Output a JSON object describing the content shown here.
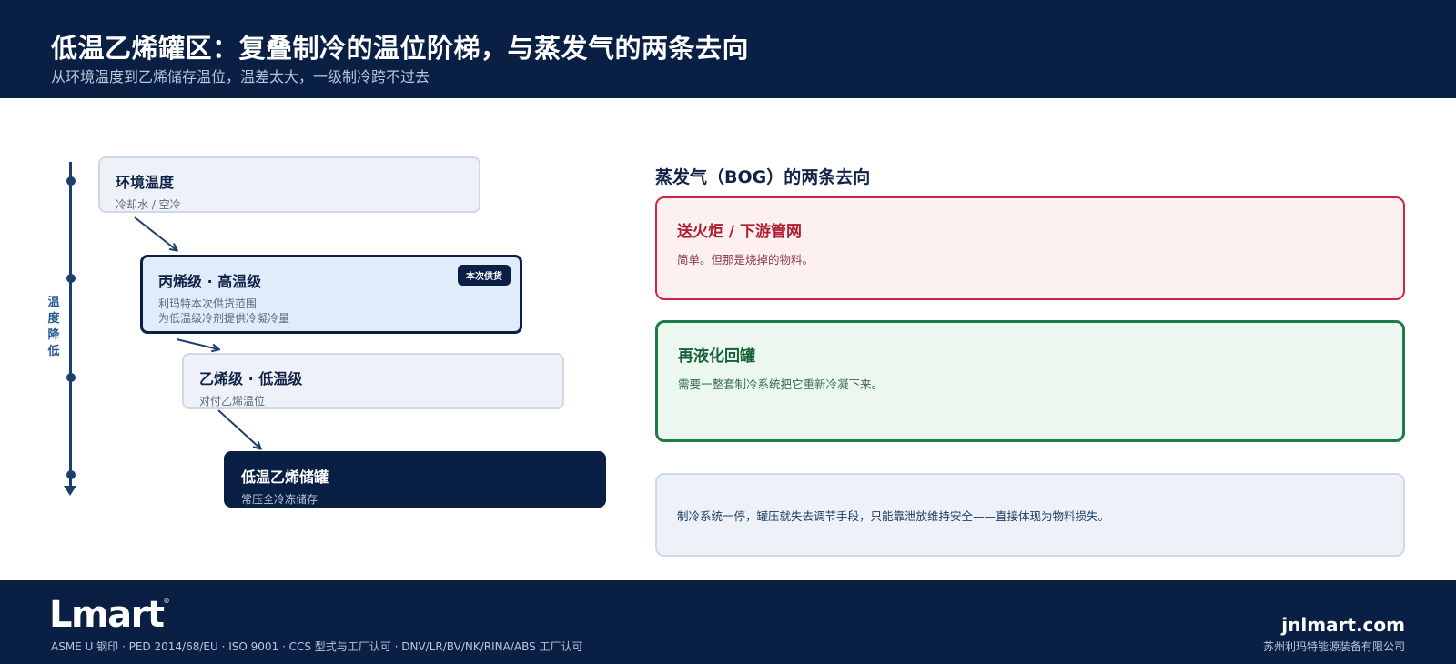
{
  "header": {
    "title": "低温乙烯罐区：复叠制冷的温位阶梯，与蒸发气的两条去向",
    "subtitle": "从环境温度到乙烯储存温位，温差太大，一级制冷跨不过去"
  },
  "ladder": {
    "axis_label": "温度降低",
    "steps": [
      {
        "title": "环境温度",
        "desc": [
          "冷却水 / 空冷"
        ]
      },
      {
        "title": "丙烯级 · 高温级",
        "desc": [
          "利玛特本次供货范围",
          "为低温级冷剂提供冷凝冷量"
        ],
        "badge": "本次供货"
      },
      {
        "title": "乙烯级 · 低温级",
        "desc": [
          "对付乙烯温位"
        ]
      },
      {
        "title": "低温乙烯储罐",
        "desc": [
          "常压全冷冻储存"
        ]
      }
    ]
  },
  "bog": {
    "title": "蒸发气（BOG）的两条去向",
    "flare": {
      "title": "送火炬 / 下游管网",
      "desc": "简单。但那是烧掉的物料。"
    },
    "reliquefy": {
      "title": "再液化回罐",
      "desc": "需要一整套制冷系统把它重新冷凝下来。"
    },
    "note": "制冷系统一停，罐压就失去调节手段，只能靠泄放维持安全——直接体现为物料损失。"
  },
  "footer": {
    "logo": "Lmart",
    "logo_mark": "®",
    "certs": "ASME U 钢印 · PED 2014/68/EU · ISO 9001 · CCS 型式与工厂认可 · DNV/LR/BV/NK/RINA/ABS 工厂认可",
    "site": "jnlmart.com",
    "company": "苏州利玛特能源装备有限公司"
  },
  "colors": {
    "navy": "#0a1f44",
    "axis": "#1d3f6e",
    "red": "#c8283a",
    "green": "#1b7c45",
    "light_panel": "#eef2f8"
  }
}
